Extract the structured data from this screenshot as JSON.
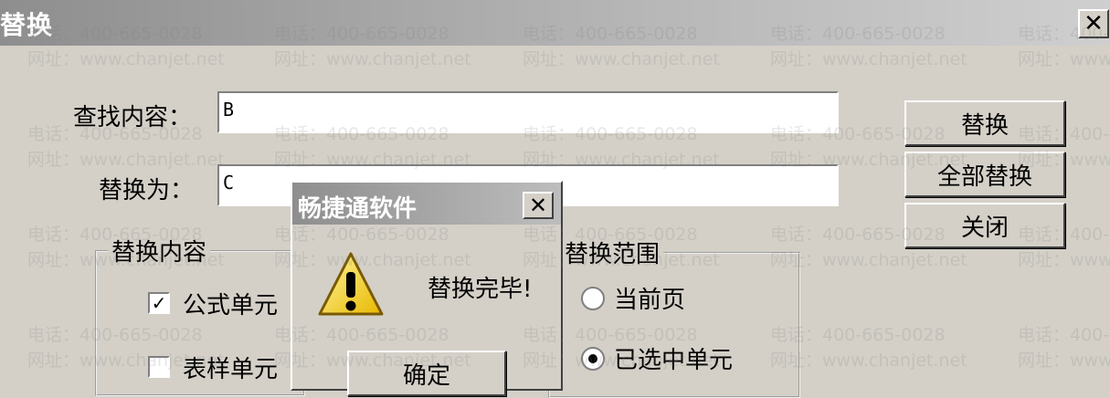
{
  "dialog": {
    "title": "替换",
    "close_glyph": "✕",
    "find_label": "查找内容：",
    "find_value": "B",
    "replace_label": "替换为：",
    "replace_value": "C",
    "buttons": {
      "replace": "替换",
      "replace_all": "全部替换",
      "close": "关闭"
    },
    "content_group": {
      "title": "替换内容",
      "options": [
        {
          "label": "公式单元",
          "checked": true
        },
        {
          "label": "表样单元",
          "checked": false
        }
      ]
    },
    "range_group": {
      "title": "替换范围",
      "options": [
        {
          "label": "当前页",
          "selected": false
        },
        {
          "label": "已选中单元",
          "selected": true
        }
      ]
    }
  },
  "popup": {
    "title": "畅捷通软件",
    "close_glyph": "✕",
    "message": "替换完毕!",
    "ok_label": "确定",
    "icon": "warning-icon"
  },
  "watermark": {
    "phone": "电话：400-665-0028",
    "site": "网址：www.chanjet.net"
  }
}
